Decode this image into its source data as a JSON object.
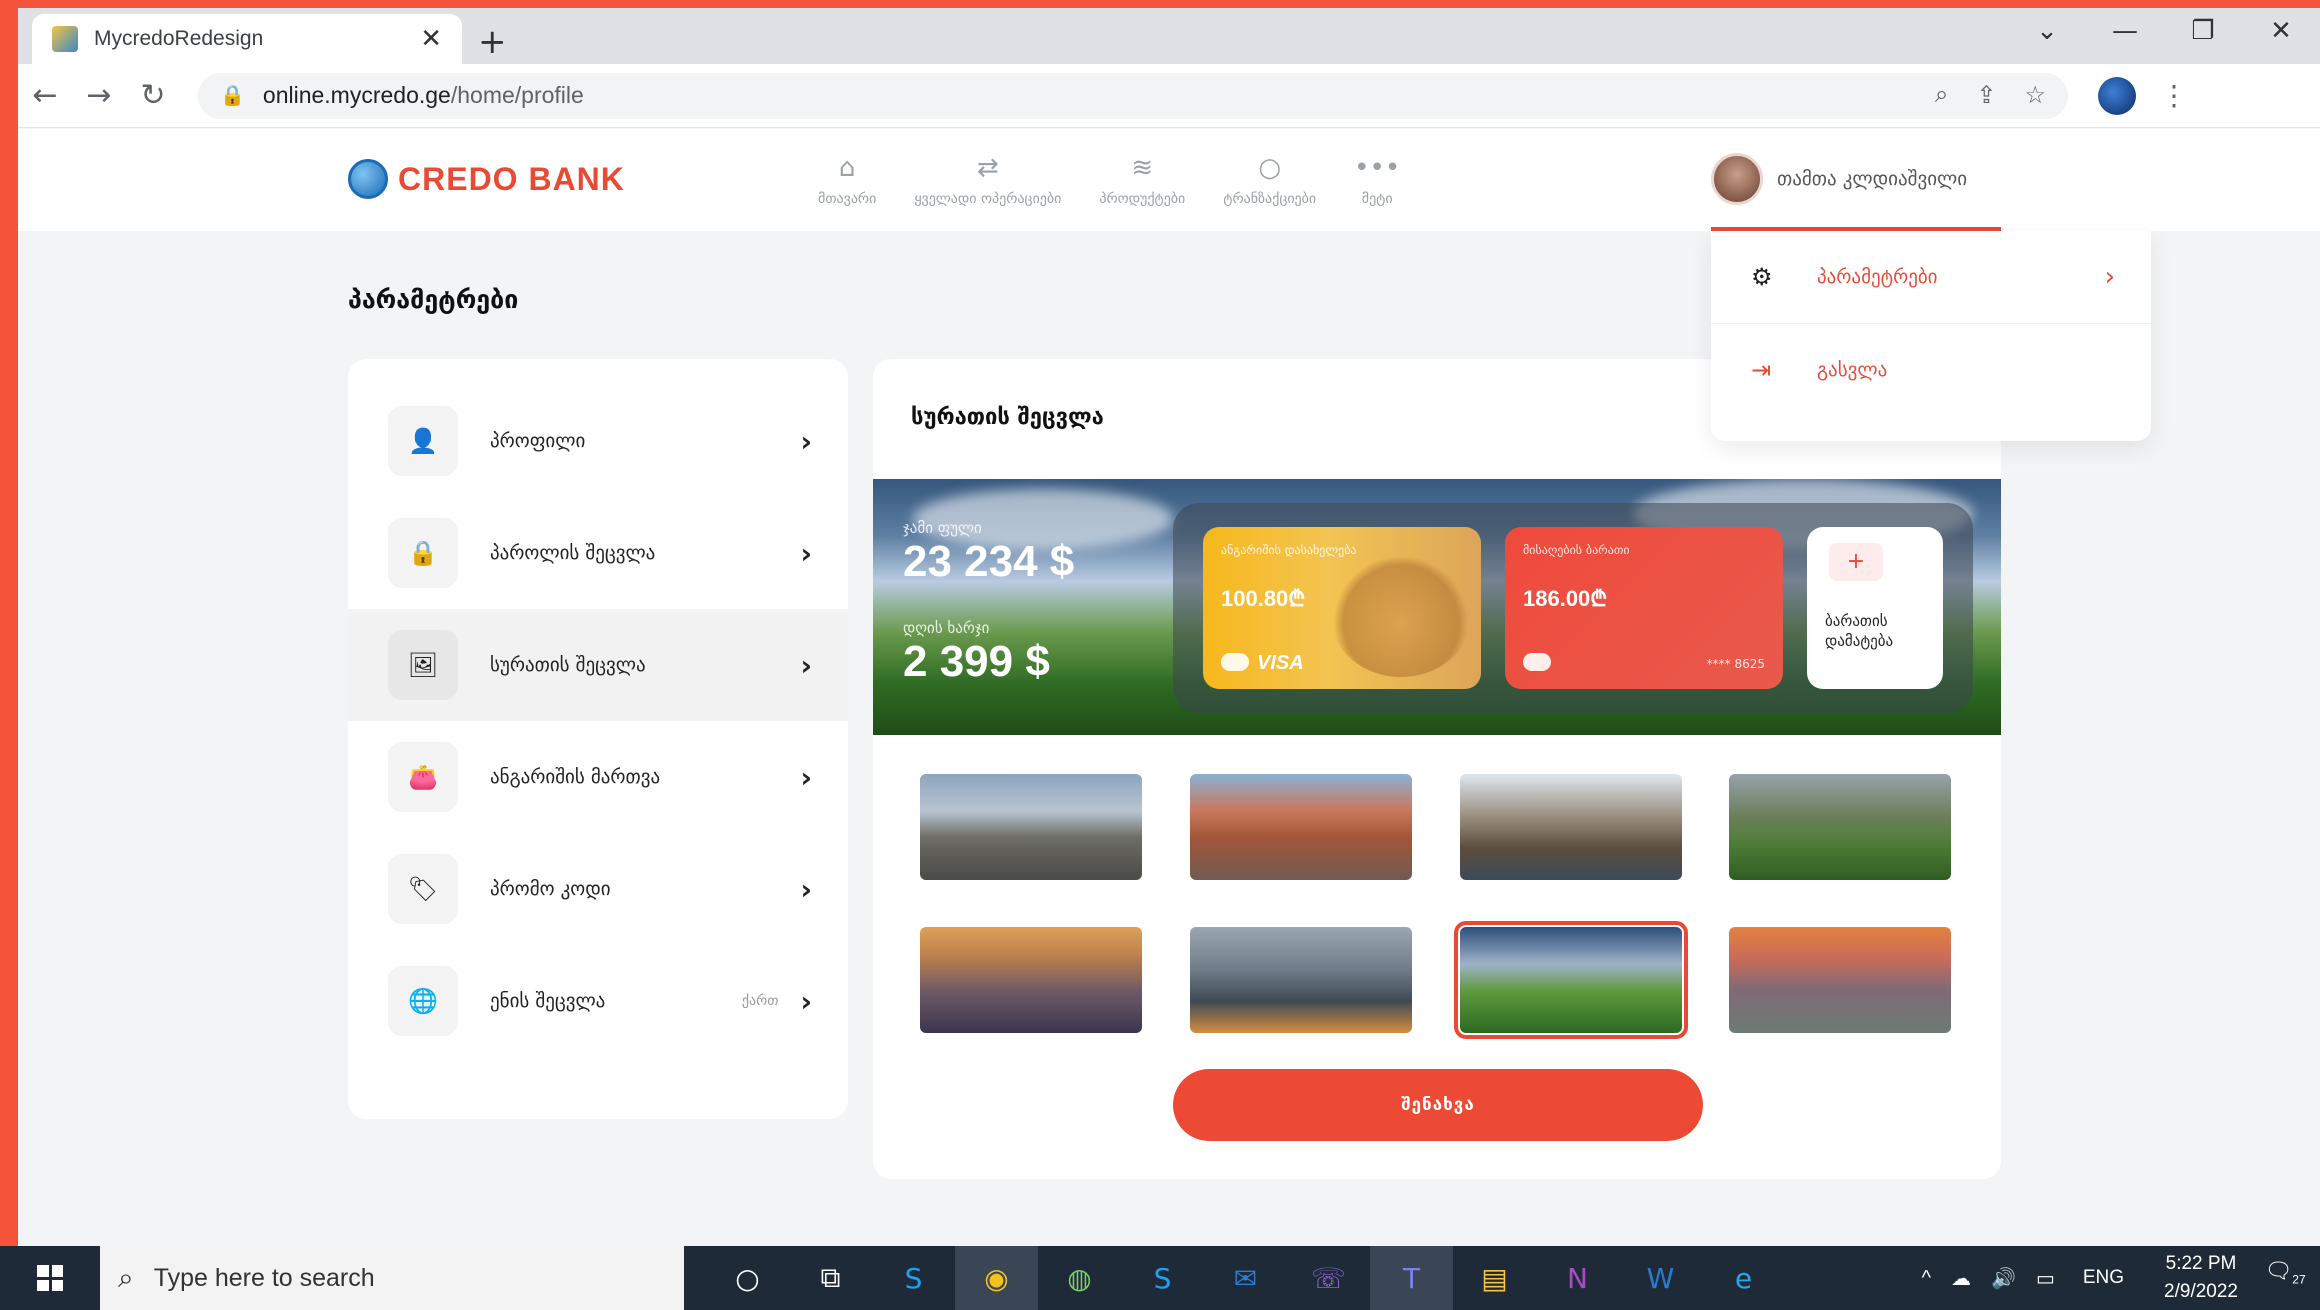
{
  "browser": {
    "tab_title": "MycredoRedesign",
    "tab_close": "✕",
    "new_tab": "+",
    "url_host": "online.mycredo.ge",
    "url_path": "/home/profile",
    "window_controls": [
      "⌄",
      "—",
      "❐",
      "✕"
    ]
  },
  "app": {
    "brand": "CREDO BANK",
    "nav": [
      {
        "label": "მთავარი",
        "icon": "home-icon",
        "glyph": "⌂"
      },
      {
        "label": "ყველადი ოპერაციები",
        "icon": "transfer-icon",
        "glyph": "⇄"
      },
      {
        "label": "პროდუქტები",
        "icon": "layers-icon",
        "glyph": "≋"
      },
      {
        "label": "ტრანზაქციები",
        "icon": "refresh-icon",
        "glyph": "○"
      },
      {
        "label": "მეტი",
        "icon": "more-icon",
        "glyph": "•••"
      }
    ],
    "user_name": "თამთა კლდიაშვილი",
    "accent": "#e84a36"
  },
  "page": {
    "title": "პარამეტრები",
    "menu": [
      {
        "label": "პროფილი",
        "icon": "user-icon",
        "glyph": "👤",
        "active": false
      },
      {
        "label": "პაროლის შეცვლა",
        "icon": "lock-icon",
        "glyph": "🔒",
        "active": false
      },
      {
        "label": "სურათის შეცვლა",
        "icon": "image-icon",
        "glyph": "🖼",
        "active": true
      },
      {
        "label": "ანგარიშის მართვა",
        "icon": "wallet-icon",
        "glyph": "👛",
        "active": false
      },
      {
        "label": "პრომო კოდი",
        "icon": "tag-icon",
        "glyph": "🏷",
        "active": false
      },
      {
        "label": "ენის შეცვლა",
        "icon": "globe-icon",
        "glyph": "🌐",
        "active": false,
        "extra": "ქართ"
      }
    ],
    "content_title": "სურათის შეცვლა",
    "banner": {
      "total_label": "ჯამი ფული",
      "total_value": "23 234 $",
      "daily_label": "დღის ხარჯი",
      "daily_value": "2 399 $",
      "cards": [
        {
          "label": "ანგარიშის დასახელება",
          "value": "100.80₾",
          "brand": "VISA"
        },
        {
          "label": "მისაღების ბარათი",
          "value": "186.00₾",
          "number": "**** 8625"
        }
      ],
      "add_card_label": "ბარათის დამატება",
      "add_card_plus": "+"
    },
    "thumbnails": [
      {
        "name": "thumb-old-town"
      },
      {
        "name": "thumb-colorful-houses"
      },
      {
        "name": "thumb-balcony-houses"
      },
      {
        "name": "thumb-mountain-tower"
      },
      {
        "name": "thumb-sunset-city"
      },
      {
        "name": "thumb-skyscraper"
      },
      {
        "name": "thumb-green-mountains",
        "selected": true
      },
      {
        "name": "thumb-evening-panorama"
      }
    ],
    "save_label": "შენახვა"
  },
  "dropdown": {
    "items": [
      {
        "label": "პარამეტრები",
        "icon": "gear-icon",
        "glyph": "⚙"
      },
      {
        "label": "გასვლა",
        "icon": "logout-icon",
        "glyph": "⇥"
      }
    ]
  },
  "taskbar": {
    "search_placeholder": "Type here to search",
    "lang": "ENG",
    "time": "5:22 PM",
    "date": "2/9/2022",
    "notif_count": "27"
  }
}
